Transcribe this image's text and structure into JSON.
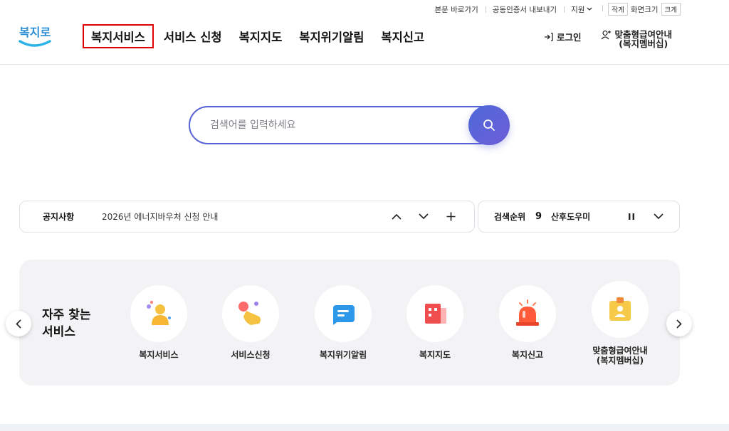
{
  "utility": {
    "skip_link": "본문 바로가기",
    "cert": "공동인증서 내보내기",
    "support": "지원",
    "small": "작게",
    "zoom_label": "화면크기",
    "large": "크게"
  },
  "logo_text": "복지로",
  "nav": {
    "items": [
      "복지서비스",
      "서비스 신청",
      "복지지도",
      "복지위기알림",
      "복지신고"
    ]
  },
  "header": {
    "login": "로그인",
    "member_line1": "맞춤형급여안내",
    "member_line2": "(복지멤버십)"
  },
  "search": {
    "placeholder": "검색어를 입력하세요"
  },
  "notice": {
    "label": "공지사항",
    "text": "2026년 에너지바우처 신청 안내"
  },
  "ranking": {
    "label": "검색순위",
    "number": "9",
    "keyword": "산후도우미"
  },
  "quick": {
    "title_line1": "자주 찾는",
    "title_line2": "서비스",
    "items": [
      {
        "label": "복지서비스",
        "icon": "person-icon"
      },
      {
        "label": "서비스신청",
        "icon": "hand-tap-icon"
      },
      {
        "label": "복지위기알림",
        "icon": "message-icon"
      },
      {
        "label": "복지지도",
        "icon": "building-icon"
      },
      {
        "label": "복지신고",
        "icon": "siren-icon"
      },
      {
        "label": "맞춤형급여안내\n(복지멤버십)",
        "icon": "id-card-icon"
      }
    ]
  },
  "colors": {
    "accent": "#5663d6",
    "active_outline": "#e30000",
    "panel_bg": "#f3f3f5"
  }
}
